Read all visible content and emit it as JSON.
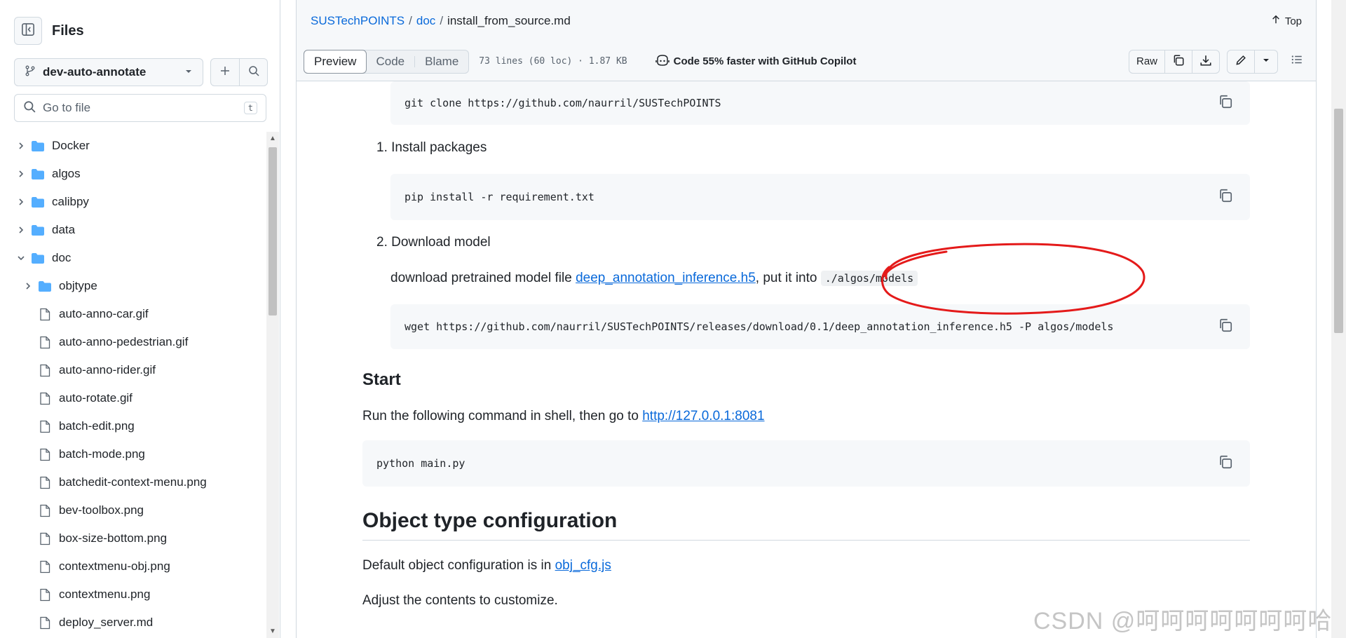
{
  "sidebar": {
    "title": "Files",
    "branch": "dev-auto-annotate",
    "goto_placeholder": "Go to file",
    "goto_shortcut": "t",
    "tree": [
      {
        "label": "Docker",
        "type": "folder",
        "expanded": false,
        "depth": 0
      },
      {
        "label": "algos",
        "type": "folder",
        "expanded": false,
        "depth": 0
      },
      {
        "label": "calibpy",
        "type": "folder",
        "expanded": false,
        "depth": 0
      },
      {
        "label": "data",
        "type": "folder",
        "expanded": false,
        "depth": 0
      },
      {
        "label": "doc",
        "type": "folder",
        "expanded": true,
        "depth": 0
      },
      {
        "label": "objtype",
        "type": "folder",
        "expanded": false,
        "depth": 1
      },
      {
        "label": "auto-anno-car.gif",
        "type": "file",
        "depth": 1
      },
      {
        "label": "auto-anno-pedestrian.gif",
        "type": "file",
        "depth": 1
      },
      {
        "label": "auto-anno-rider.gif",
        "type": "file",
        "depth": 1
      },
      {
        "label": "auto-rotate.gif",
        "type": "file",
        "depth": 1
      },
      {
        "label": "batch-edit.png",
        "type": "file",
        "depth": 1
      },
      {
        "label": "batch-mode.png",
        "type": "file",
        "depth": 1
      },
      {
        "label": "batchedit-context-menu.png",
        "type": "file",
        "depth": 1
      },
      {
        "label": "bev-toolbox.png",
        "type": "file",
        "depth": 1
      },
      {
        "label": "box-size-bottom.png",
        "type": "file",
        "depth": 1
      },
      {
        "label": "contextmenu-obj.png",
        "type": "file",
        "depth": 1
      },
      {
        "label": "contextmenu.png",
        "type": "file",
        "depth": 1
      },
      {
        "label": "deploy_server.md",
        "type": "file",
        "depth": 1
      }
    ]
  },
  "header": {
    "crumb_repo": "SUSTechPOINTS",
    "crumb_dir": "doc",
    "crumb_file": "install_from_source.md",
    "top_label": "Top"
  },
  "toolbar": {
    "tabs": [
      "Preview",
      "Code",
      "Blame"
    ],
    "active_tab": "Preview",
    "meta": "73 lines (60 loc) · 1.87 KB",
    "copilot": "Code 55% faster with GitHub Copilot",
    "raw_label": "Raw"
  },
  "content": {
    "code1": "git clone https://github.com/naurril/SUSTechPOINTS",
    "item1": "1. Install packages",
    "code2": "pip install -r requirement.txt",
    "item2": "2. Download model",
    "download_prefix": "download pretrained model file ",
    "download_link": "deep_annotation_inference.h5",
    "download_mid": ", put it into ",
    "download_path": "./algos/models",
    "code3": "wget https://github.com/naurril/SUSTechPOINTS/releases/download/0.1/deep_annotation_inference.h5  -P algos/models",
    "start_heading": "Start",
    "start_prefix": "Run the following command in shell, then go to ",
    "start_link": "http://127.0.0.1:8081",
    "code4": "python main.py",
    "obj_heading": "Object type configuration",
    "obj_prefix": "Default object configuration is in ",
    "obj_link": "obj_cfg.js",
    "adjust": "Adjust the contents to customize."
  },
  "watermark": "CSDN @呵呵呵呵呵呵呵哈",
  "colors": {
    "link": "#0969da",
    "folder": "#54aeff",
    "annotation": "#e41a1a"
  }
}
